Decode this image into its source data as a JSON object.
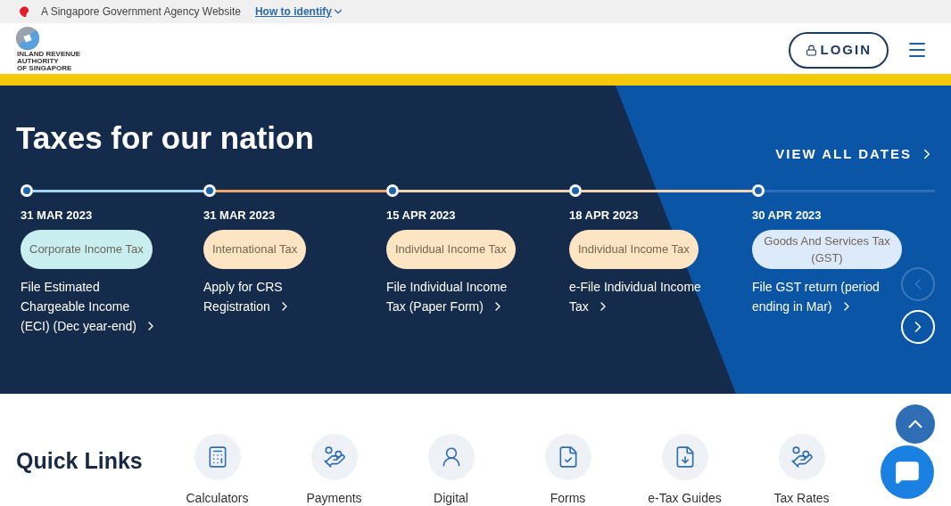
{
  "gov_banner": {
    "text": "A Singapore Government Agency Website",
    "link": "How to identify"
  },
  "header": {
    "logo_lines": [
      "INLAND REVENUE",
      "AUTHORITY",
      "OF SINGAPORE"
    ],
    "login": "LOGIN"
  },
  "hero": {
    "title": "Taxes for our nation",
    "view_all": "VIEW ALL DATES",
    "items": [
      {
        "date": "31 MAR 2023",
        "tag": "Corporate Income Tax",
        "color": "#c9eef0",
        "description": "File Estimated Chargeable Income (ECI) (Dec year-end)"
      },
      {
        "date": "31 MAR 2023",
        "tag": "International Tax",
        "color": "#fde5c3",
        "description": "Apply for CRS Registration"
      },
      {
        "date": "15 APR 2023",
        "tag": "Individual Income Tax",
        "color": "#fde5c3",
        "description": "File Individual Income Tax (Paper Form)"
      },
      {
        "date": "18 APR 2023",
        "tag": "Individual Income Tax",
        "color": "#fde5c3",
        "description": "e-File Individual Income Tax"
      },
      {
        "date": "30 APR 2023",
        "tag": "Goods And Services Tax (GST)",
        "color": "#dceafc",
        "description": "File GST return (period ending in Mar)"
      }
    ],
    "prev": {
      "disabled": true
    },
    "next": {
      "disabled": false
    }
  },
  "quick_links": {
    "title": "Quick Links",
    "items": [
      {
        "label": "Calculators",
        "kind": "calculator"
      },
      {
        "label": "Payments",
        "kind": "payment"
      },
      {
        "label": "Digital",
        "kind": "digital"
      },
      {
        "label": "Forms",
        "kind": "form"
      },
      {
        "label": "e-Tax Guides",
        "kind": "guide"
      },
      {
        "label": "Tax Rates",
        "kind": "rate"
      }
    ]
  }
}
